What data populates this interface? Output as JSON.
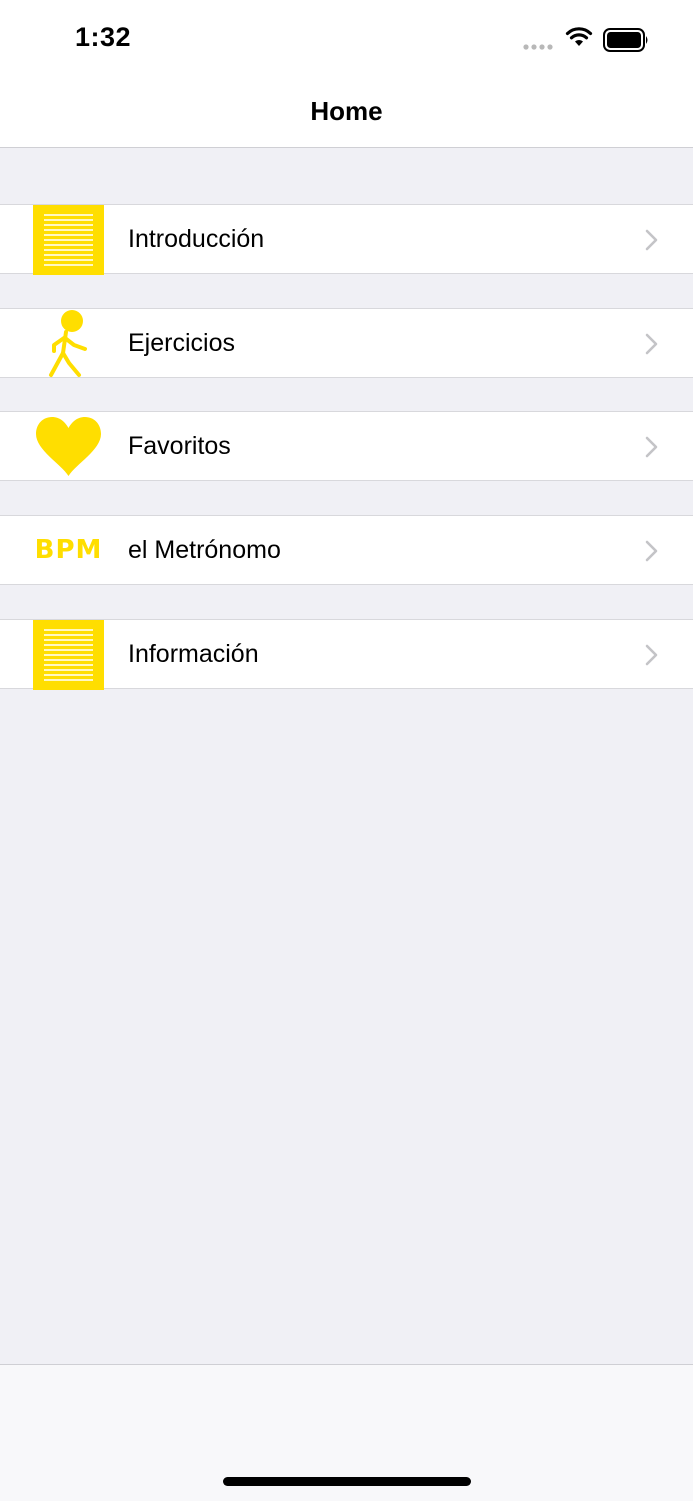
{
  "status_bar": {
    "time": "1:32",
    "icons": [
      "signal-dots-icon",
      "wifi-icon",
      "battery-icon"
    ]
  },
  "nav": {
    "title": "Home"
  },
  "accent_color": "#ffde00",
  "menu": {
    "items": [
      {
        "label": "Introducción",
        "icon": "document-lines-icon"
      },
      {
        "label": "Ejercicios",
        "icon": "walking-person-icon"
      },
      {
        "label": "Favoritos",
        "icon": "heart-icon"
      },
      {
        "label": "el Metrónomo",
        "icon": "bpm-icon",
        "icon_text": "BPM"
      },
      {
        "label": "Información",
        "icon": "document-lines-icon"
      }
    ]
  }
}
